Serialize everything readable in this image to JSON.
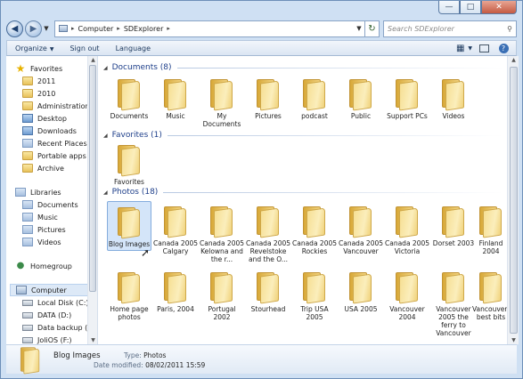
{
  "window": {
    "minimize_label": "—",
    "maximize_label": "□",
    "close_label": "✕"
  },
  "address": {
    "crumbs": [
      "Computer",
      "SDExplorer"
    ],
    "separator": "▸",
    "search_placeholder": "Search SDExplorer"
  },
  "toolbar": {
    "organize": "Organize",
    "sign_out": "Sign out",
    "language": "Language"
  },
  "nav": {
    "favorites": "Favorites",
    "favorite_items": [
      "2011",
      "2010",
      "Administration",
      "Desktop",
      "Downloads",
      "Recent Places",
      "Portable apps",
      "Archive"
    ],
    "libraries": "Libraries",
    "library_items": [
      "Documents",
      "Music",
      "Pictures",
      "Videos"
    ],
    "homegroup": "Homegroup",
    "computer": "Computer",
    "drives": [
      "Local Disk (C:)",
      "DATA (D:)",
      "Data backup (E:)",
      "JoliOS (F:)"
    ]
  },
  "groups": {
    "documents": {
      "header": "Documents (8)",
      "items": [
        "Documents",
        "Music",
        "My Documents",
        "Pictures",
        "podcast",
        "Public",
        "Support PCs",
        "Videos"
      ]
    },
    "favorites": {
      "header": "Favorites (1)",
      "items": [
        "Favorites"
      ]
    },
    "photos": {
      "header": "Photos (18)",
      "row1": [
        "Blog Images",
        "Canada 2005 Calgary",
        "Canada 2005 Kelowna and the r...",
        "Canada 2005 Revelstoke and the O...",
        "Canada 2005 Rockies",
        "Canada 2005 Vancouver",
        "Canada 2005 Victoria",
        "Dorset 2003",
        "Finland 2004"
      ],
      "row2": [
        "Home page photos",
        "Paris, 2004",
        "Portugal 2002",
        "Stourhead",
        "Trip USA 2005",
        "USA 2005",
        "Vancouver 2004",
        "Vancouver 2005 the ferry to Vancouver",
        "Vancouver's best bits"
      ]
    }
  },
  "details": {
    "name": "Blog Images",
    "type_label": "Type:",
    "type_value": "Photos",
    "modified_label": "Date modified:",
    "modified_value": "08/02/2011 15:59"
  }
}
